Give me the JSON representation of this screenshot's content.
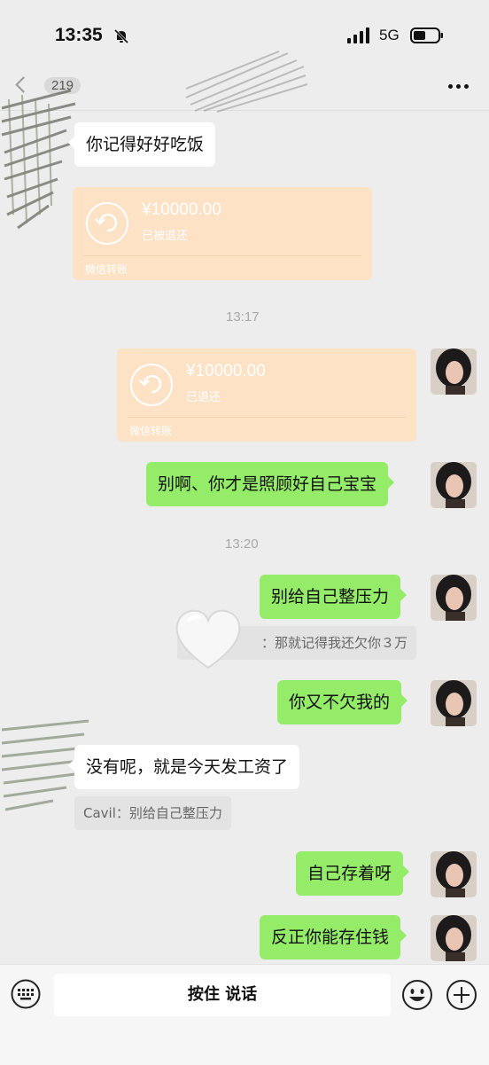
{
  "status": {
    "time": "13:35",
    "network": "5G"
  },
  "nav": {
    "unread_count": "219"
  },
  "messages": [
    {
      "side": "in",
      "text": "你记得好好吃饭"
    },
    {
      "side": "in",
      "type": "transfer",
      "amount": "¥10000.00",
      "status": "已被退还",
      "brand": "微信转账"
    },
    {
      "type": "time",
      "text": "13:17"
    },
    {
      "side": "out",
      "type": "transfer",
      "amount": "¥10000.00",
      "status": "已退还",
      "brand": "微信转账"
    },
    {
      "side": "out",
      "text": "别啊、你才是照顾好自己宝宝"
    },
    {
      "type": "time",
      "text": "13:20"
    },
    {
      "side": "out",
      "text": "别给自己整压力"
    },
    {
      "side": "out",
      "type": "quote",
      "text": "：那就记得我还欠你３万"
    },
    {
      "side": "out",
      "text": "你又不欠我的"
    },
    {
      "side": "in",
      "text": "没有呢，就是今天发工资了"
    },
    {
      "side": "in",
      "type": "quote",
      "text": "Cavil：别给自己整压力"
    },
    {
      "side": "out",
      "text": "自己存着呀"
    },
    {
      "side": "out",
      "text": "反正你能存住钱"
    }
  ],
  "input": {
    "hold_to_talk": "按住 说话"
  },
  "colors": {
    "background": "#ededed",
    "outgoing_bubble": "#95ec69",
    "incoming_bubble": "#ffffff",
    "transfer_card": "#fde2c6"
  },
  "icons": [
    "mute-icon",
    "signal-icon",
    "battery-icon",
    "back-chevron-icon",
    "more-icon",
    "transfer-returned-icon",
    "voice-keyboard-icon",
    "emoji-icon",
    "plus-icon",
    "heart-sticker"
  ]
}
